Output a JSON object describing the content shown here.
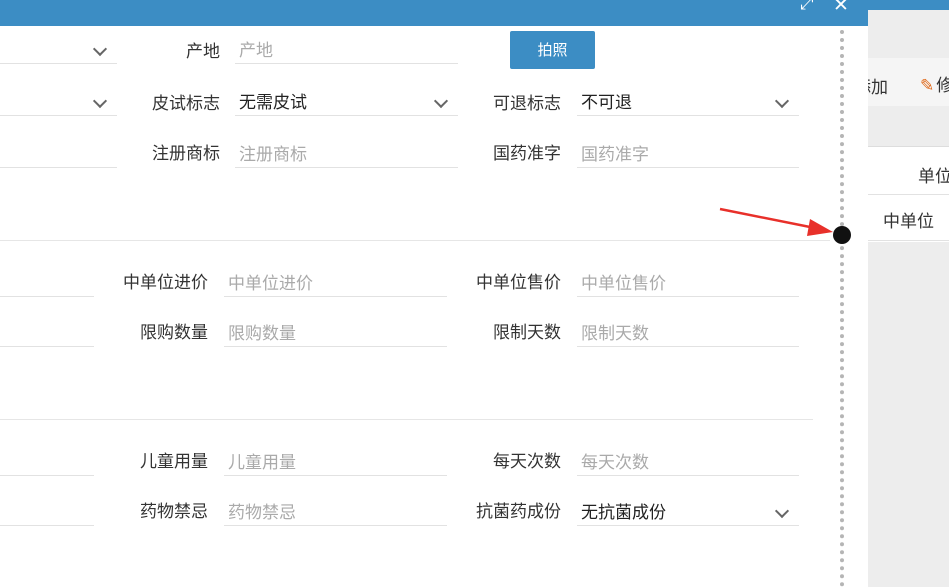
{
  "window": {
    "expand_icon": "expand-icon",
    "close_icon": "close-icon",
    "close_glyph": "✕",
    "expand_glyph": "⤢"
  },
  "background": {
    "toolbar": {
      "add_label": "添加",
      "edit_label": "修"
    },
    "table": {
      "header": "单位",
      "cell": "中单位"
    }
  },
  "form": {
    "photo_button": "拍照",
    "origin": {
      "label": "产地",
      "placeholder": "产地"
    },
    "skin_test": {
      "label": "皮试标志",
      "value": "无需皮试"
    },
    "returnable": {
      "label": "可退标志",
      "value": "不可退"
    },
    "trademark": {
      "label": "注册商标",
      "placeholder": "注册商标"
    },
    "approval": {
      "label": "国药准字",
      "placeholder": "国药准字"
    },
    "mid_purchase": {
      "label": "中单位进价",
      "placeholder": "中单位进价"
    },
    "mid_sale": {
      "label": "中单位售价",
      "placeholder": "中单位售价"
    },
    "limit_qty": {
      "label": "限购数量",
      "placeholder": "限购数量"
    },
    "limit_days": {
      "label": "限制天数",
      "placeholder": "限制天数"
    },
    "child_dose": {
      "label": "儿童用量",
      "placeholder": "儿童用量"
    },
    "daily_times": {
      "label": "每天次数",
      "placeholder": "每天次数"
    },
    "contraindication": {
      "label": "药物禁忌",
      "placeholder": "药物禁忌"
    },
    "antibacterial": {
      "label": "抗菌药成份",
      "value": "无抗菌成份"
    }
  },
  "colors": {
    "header_blue": "#3c8dc4",
    "arrow_red": "#e8302a"
  }
}
